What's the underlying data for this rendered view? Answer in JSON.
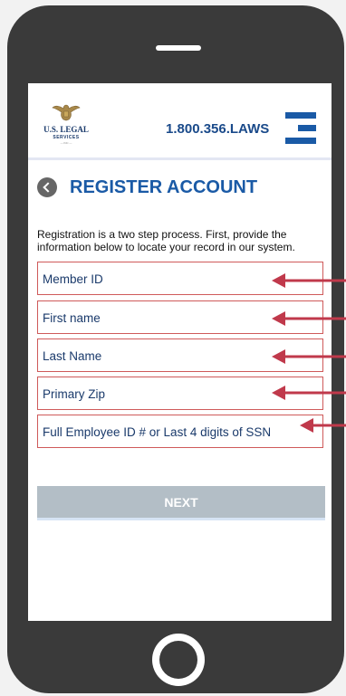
{
  "header": {
    "logo_name": "U.S. LEGAL",
    "logo_sub": "SERVICES",
    "logo_tm": "— INC —",
    "phone": "1.800.356.LAWS",
    "menu_icon": "hamburger-menu-icon"
  },
  "page": {
    "title": "REGISTER ACCOUNT",
    "intro": "Registration is a two step process. First, provide the information below to locate your record in our system."
  },
  "form": {
    "fields": [
      {
        "placeholder": "Member ID"
      },
      {
        "placeholder": "First name"
      },
      {
        "placeholder": "Last Name"
      },
      {
        "placeholder": "Primary Zip"
      },
      {
        "placeholder": "Full Employee ID # or Last 4 digits of SSN"
      }
    ],
    "next_label": "NEXT"
  },
  "colors": {
    "brand_blue": "#1a5aa6",
    "field_border": "#cf5a5a",
    "arrow": "#c0394b",
    "button": "#b3bec6",
    "phone_body": "#3a3a3a"
  }
}
